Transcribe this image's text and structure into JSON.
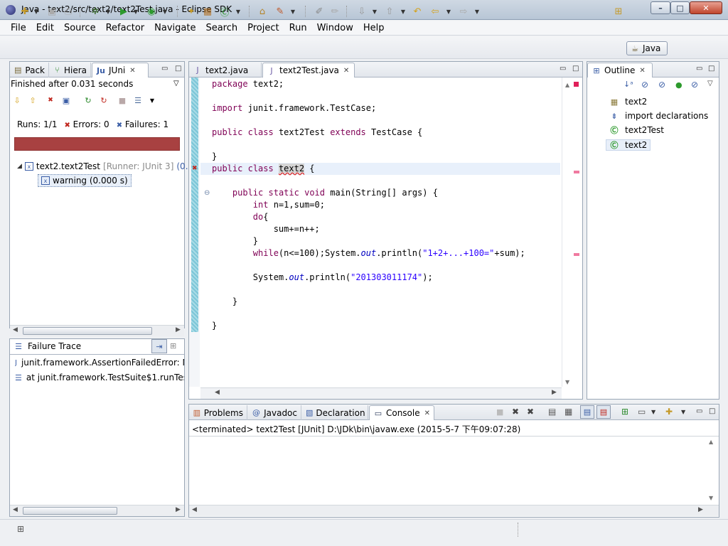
{
  "window": {
    "title": "Java - text2/src/text2/text2Test.java - Eclipse SDK",
    "minimize": "–",
    "maximize": "□",
    "close": "✕"
  },
  "menu": [
    "File",
    "Edit",
    "Source",
    "Refactor",
    "Navigate",
    "Search",
    "Project",
    "Run",
    "Window",
    "Help"
  ],
  "perspective": {
    "label": "Java",
    "icon": "java-perspective-icon"
  },
  "left_tabs": [
    {
      "label": "Pack",
      "icon": "package-explorer-icon"
    },
    {
      "label": "Hiera",
      "icon": "hierarchy-icon"
    },
    {
      "label": "JUni",
      "icon": "junit-icon",
      "active": true
    }
  ],
  "junit": {
    "status": "Finished after 0.031 seconds",
    "runs_label": "Runs:",
    "runs_value": "1/1",
    "errors_label": "Errors:",
    "errors_value": "0",
    "failures_label": "Failures:",
    "failures_value": "1",
    "bar_color": "#a84141",
    "tree_root": {
      "name": "text2.text2Test",
      "runner": "[Runner: JUnit 3]",
      "time_fragment": "(0."
    },
    "tree_child": {
      "name": "warning (0.000 s)"
    }
  },
  "failure_trace": {
    "title": "Failure Trace",
    "lines": [
      "junit.framework.AssertionFailedError: N",
      "at junit.framework.TestSuite$1.runTest"
    ]
  },
  "editor": {
    "tabs": [
      {
        "label": "text2.java",
        "active": false
      },
      {
        "label": "text2Test.java",
        "active": true
      }
    ]
  },
  "outline": {
    "tab_label": "Outline",
    "items": [
      {
        "label": "text2",
        "icon": "package-icon"
      },
      {
        "label": "import declarations",
        "icon": "imports-icon"
      },
      {
        "label": "text2Test",
        "icon": "class-icon"
      },
      {
        "label": "text2",
        "icon": "class-error-icon"
      }
    ]
  },
  "bottom_tabs": [
    {
      "label": "Problems",
      "icon": "problems-icon"
    },
    {
      "label": "Javadoc",
      "icon": "javadoc-icon"
    },
    {
      "label": "Declaration",
      "icon": "declaration-icon"
    },
    {
      "label": "Console",
      "icon": "console-icon",
      "active": true
    }
  ],
  "console": {
    "status": "<terminated> text2Test [JUnit] D:\\JDk\\bin\\javaw.exe (2015-5-7 下午09:07:28)"
  }
}
